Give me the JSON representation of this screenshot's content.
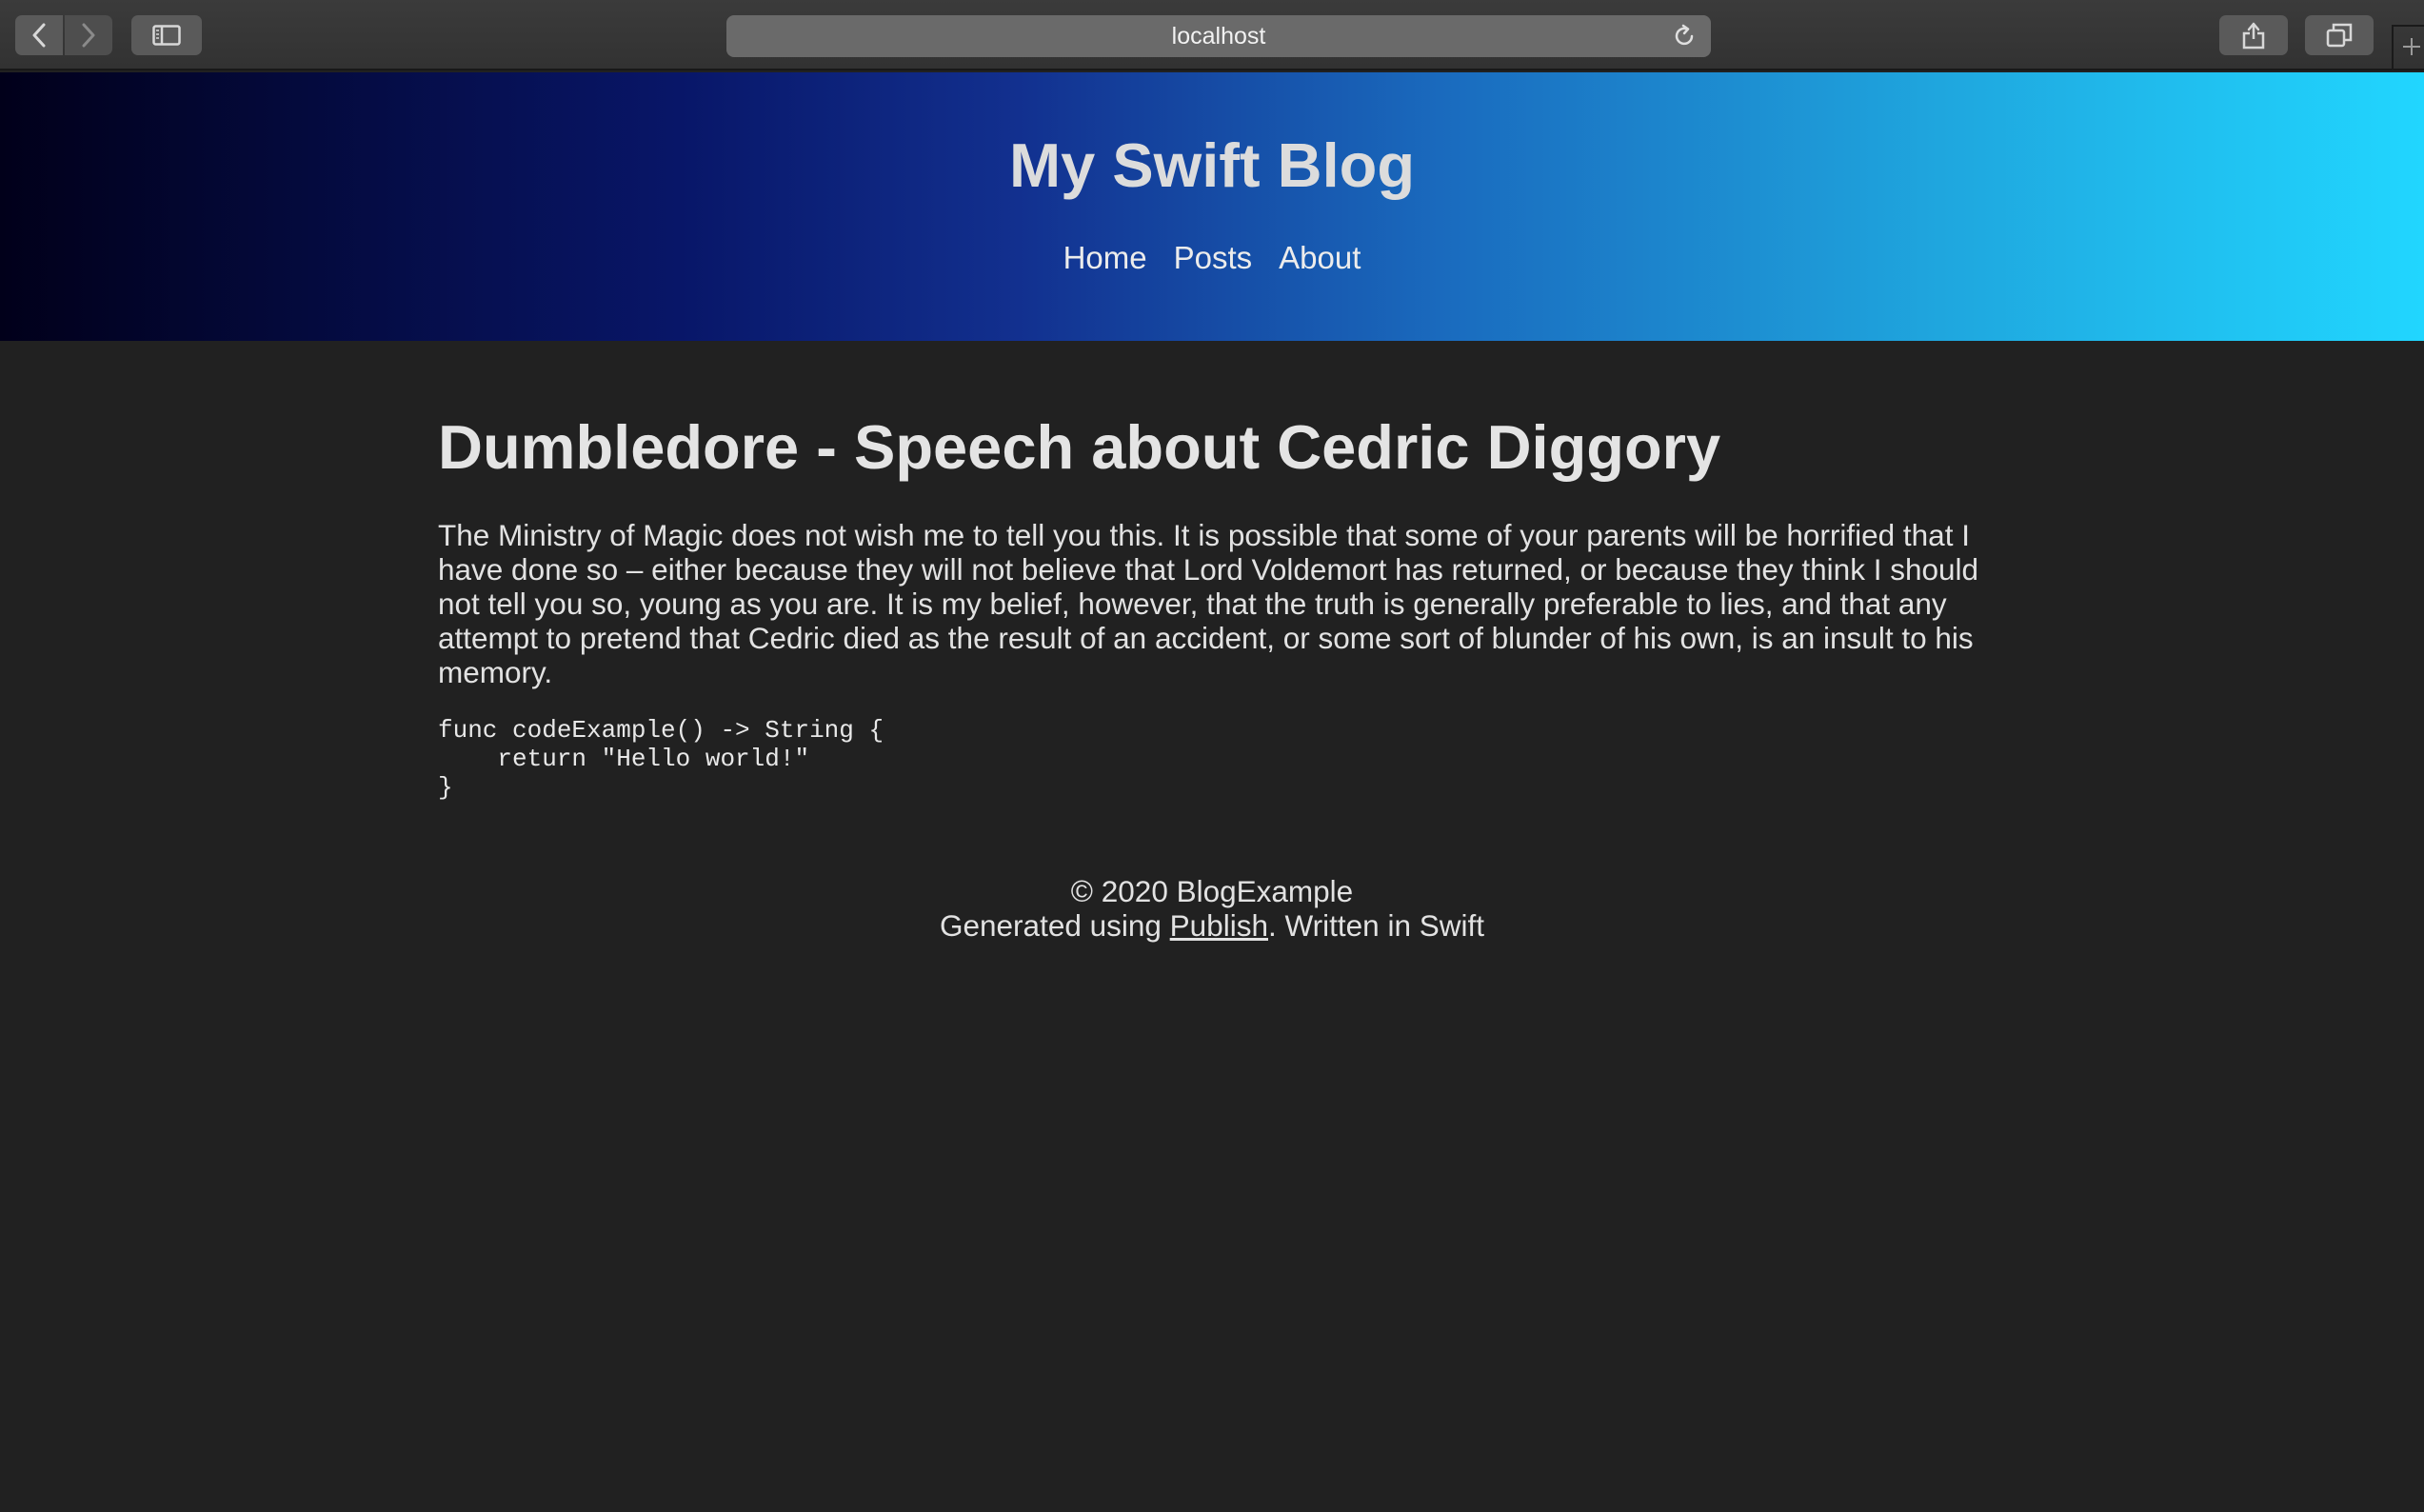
{
  "browser": {
    "address": "localhost",
    "icons": {
      "back": "chevron-left-icon",
      "forward": "chevron-right-icon",
      "sidebar": "sidebar-icon",
      "reload": "reload-icon",
      "share": "share-icon",
      "tabs": "tab-overview-icon",
      "new_tab": "plus-icon"
    }
  },
  "header": {
    "title": "My Swift Blog",
    "nav": [
      "Home",
      "Posts",
      "About"
    ],
    "gradient_colors": [
      "#01001a",
      "#081668",
      "#12308f",
      "#1a6cbf",
      "#1fa6de",
      "#21d6ff"
    ]
  },
  "post": {
    "title": "Dumbledore - Speech about Cedric Diggory",
    "body": "The Ministry of Magic does not wish me to tell you this. It is possible that some of your parents will be horrified that I have done so – either because they will not believe that Lord Voldemort has returned, or because they think I should not tell you so, young as you are. It is my belief, however, that the truth is generally preferable to lies, and that any attempt to pretend that Cedric died as the result of an accident, or some sort of blunder of his own, is an insult to his memory.",
    "code": "func codeExample() -> String {\n    return \"Hello world!\"\n}"
  },
  "footer": {
    "copyright": "© 2020 BlogExample",
    "generated_prefix": "Generated using ",
    "publish_link": "Publish",
    "generated_suffix": ". Written in Swift"
  },
  "colors": {
    "page_background": "#212121",
    "text": "#e2e2e2"
  }
}
